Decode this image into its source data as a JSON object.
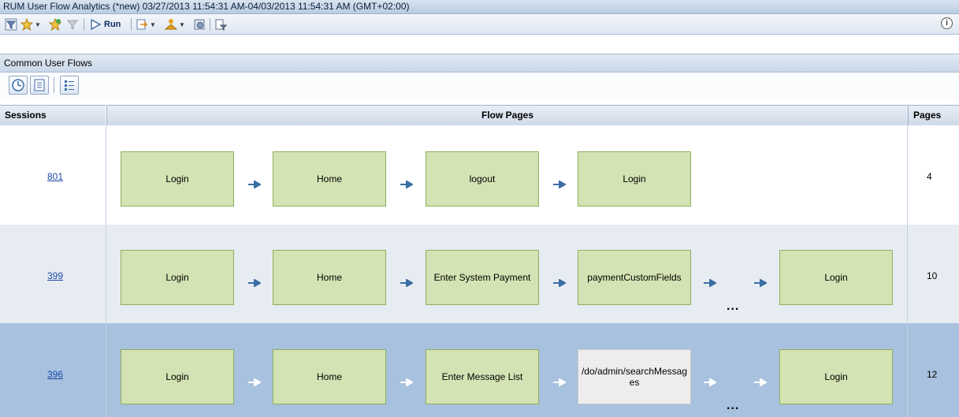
{
  "window": {
    "title": "RUM User Flow Analytics (*new) 03/27/2013 11:54:31 AM-04/03/2013 11:54:31 AM (GMT+02:00)"
  },
  "toolbar": {
    "run_label": "Run",
    "icons": [
      "filter-icon",
      "favorites-icon",
      "add-favorite-icon",
      "clear-filter-icon",
      "run-icon",
      "export-icon",
      "view-icon",
      "settings-icon",
      "active-filters-icon",
      "info-icon"
    ],
    "info_label": "i"
  },
  "panel": {
    "title": "Common User Flows"
  },
  "subtoolbar": {
    "icons": [
      "time-range-icon",
      "export-list-icon",
      "legend-icon"
    ]
  },
  "table": {
    "headers": {
      "sessions": "Sessions",
      "flow_pages": "Flow Pages",
      "pages": "Pages"
    },
    "rows": [
      {
        "sessions": "801",
        "pages": "4",
        "truncated": false,
        "selected": false,
        "flow": [
          "Login",
          "Home",
          "logout",
          "Login"
        ]
      },
      {
        "sessions": "399",
        "pages": "10",
        "truncated": true,
        "selected": false,
        "flow": [
          "Login",
          "Home",
          "Enter System Payment",
          "paymentCustomFields"
        ],
        "last": "Login",
        "ellipsis": "..."
      },
      {
        "sessions": "396",
        "pages": "12",
        "truncated": true,
        "selected": true,
        "flow": [
          "Login",
          "Home",
          "Enter Message List",
          "/do/admin/searchMessages"
        ],
        "last": "Login",
        "ellipsis": "..."
      }
    ]
  },
  "colors": {
    "box_fill": "#d3e3b3",
    "box_border": "#8faf5e",
    "row_alt": "#e7ecf2",
    "row_selected": "#a8c1de",
    "arrow": "#3b6ea5",
    "link": "#1a4aa8"
  }
}
